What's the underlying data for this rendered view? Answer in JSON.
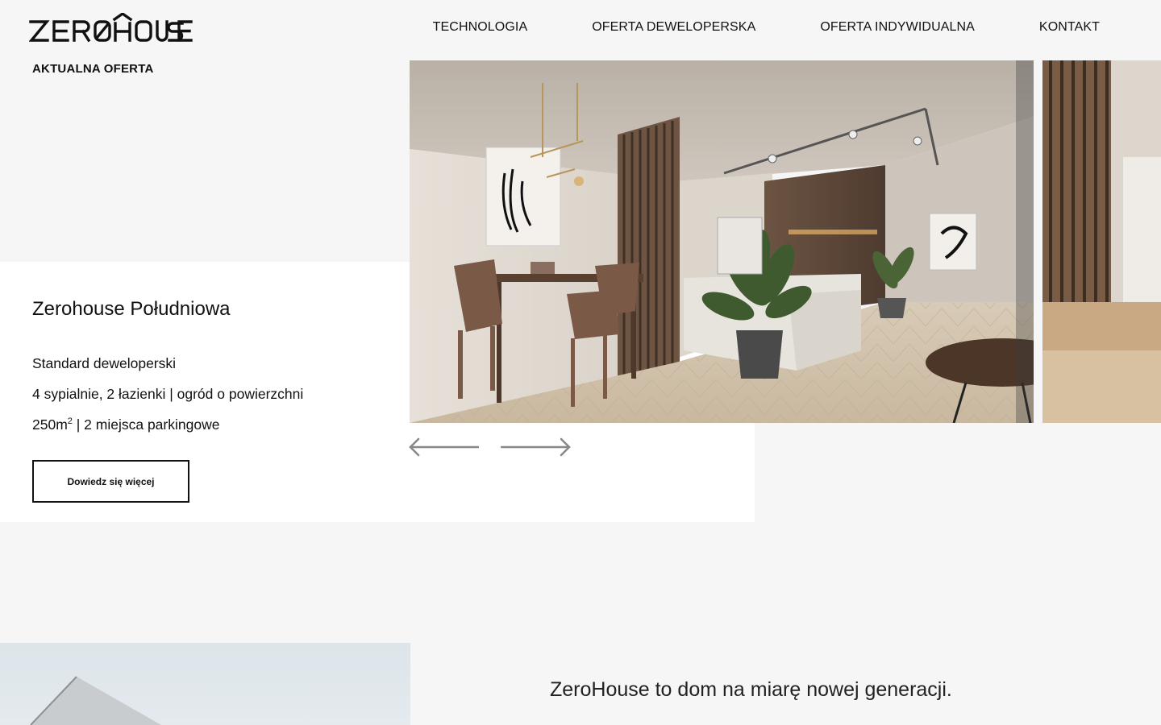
{
  "brand": {
    "logo_text": "ZER0HOUSE"
  },
  "nav": {
    "items": [
      "TECHNOLOGIA",
      "OFERTA DEWELOPERSKA",
      "OFERTA INDYWIDUALNA",
      "KONTAKT"
    ]
  },
  "offer": {
    "section_label": "AKTUALNA OFERTA",
    "title": "Zerohouse Południowa",
    "line1": "Standard deweloperski",
    "line2": "4 sypialnie, 2 łazienki | ogród o powierzchni",
    "line3_prefix": "250m",
    "line3_sup": "2",
    "line3_suffix": " | 2 miejsca parkingowe",
    "button_label": "Dowiedz się więcej"
  },
  "slider": {
    "slides": [
      "interior-dining-living-photo",
      "interior-wood-slats-photo"
    ],
    "prev_icon": "arrow-left-icon",
    "next_icon": "arrow-right-icon"
  },
  "about": {
    "tagline": "ZeroHouse to dom na miarę nowej generacji."
  },
  "colors": {
    "background": "#f6f6f6",
    "card": "#ffffff",
    "text": "#111111"
  }
}
